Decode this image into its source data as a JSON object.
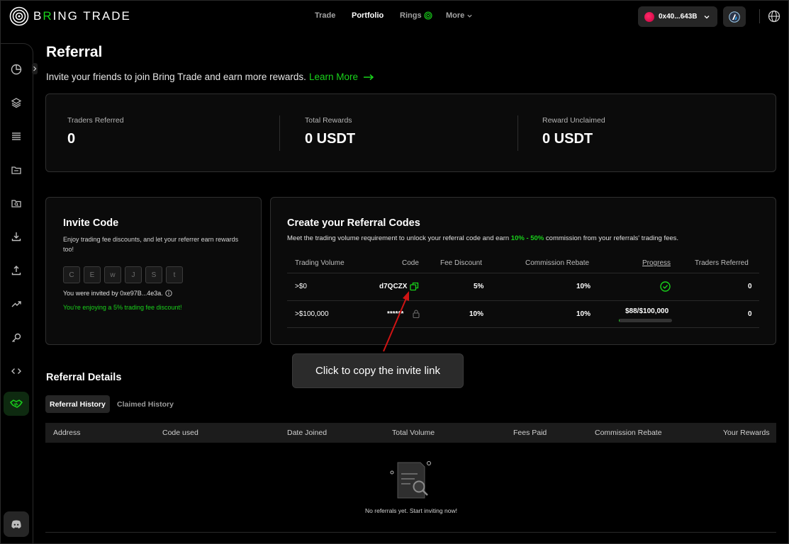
{
  "brand": {
    "name_pre": "B",
    "name_r": "R",
    "name_post": "ING TRADE"
  },
  "nav": [
    {
      "label": "Trade"
    },
    {
      "label": "Portfolio"
    },
    {
      "label": "Rings"
    },
    {
      "label": "More"
    }
  ],
  "wallet": {
    "address": "0x40...643B"
  },
  "page": {
    "title": "Referral",
    "subtitle": "Invite your friends to join Bring Trade and earn more rewards.",
    "learn_more": "Learn More"
  },
  "stats": [
    {
      "label": "Traders Referred",
      "value": "0"
    },
    {
      "label": "Total Rewards",
      "value": "0 USDT"
    },
    {
      "label": "Reward Unclaimed",
      "value": "0 USDT"
    }
  ],
  "invite": {
    "title": "Invite Code",
    "description": "Enjoy trading fee discounts, and let your referrer earn rewards too!",
    "code_chars": [
      "C",
      "E",
      "w",
      "J",
      "S",
      "t"
    ],
    "invited_by": "You were invited by 0xe97B...4e3a.",
    "discount_text": "You're enjoying a 5% trading fee discount!"
  },
  "referral_codes": {
    "title": "Create your Referral Codes",
    "desc_pre": "Meet the trading volume requirement to unlock your referral code and earn",
    "desc_highlight": "10% - 50%",
    "desc_post": "commission from your referrals' trading fees.",
    "headers": [
      "Trading Volume",
      "Code",
      "Fee Discount",
      "Commission Rebate",
      "Progress",
      "Traders Referred"
    ],
    "rows": [
      {
        "volume": ">$0",
        "code": "d7QCZX",
        "discount": "5%",
        "rebate": "10%",
        "progress": "",
        "traders": "0"
      },
      {
        "volume": ">$100,000",
        "code": "******",
        "discount": "10%",
        "rebate": "10%",
        "progress": "$88/$100,000",
        "traders": "0"
      }
    ],
    "progress_fraction": 0.00088
  },
  "tooltip": {
    "text": "Click to copy the invite link"
  },
  "details": {
    "title": "Referral Details",
    "tabs": [
      {
        "label": "Referral History"
      },
      {
        "label": "Claimed History"
      }
    ],
    "columns": [
      "Address",
      "Code used",
      "Date Joined",
      "Total Volume",
      "Fees Paid",
      "Commission Rebate",
      "Your Rewards"
    ],
    "empty_text": "No referrals yet. Start inviting now!"
  },
  "colors": {
    "accent": "#19d21b",
    "background": "#000000",
    "card": "#0b0b0b"
  }
}
